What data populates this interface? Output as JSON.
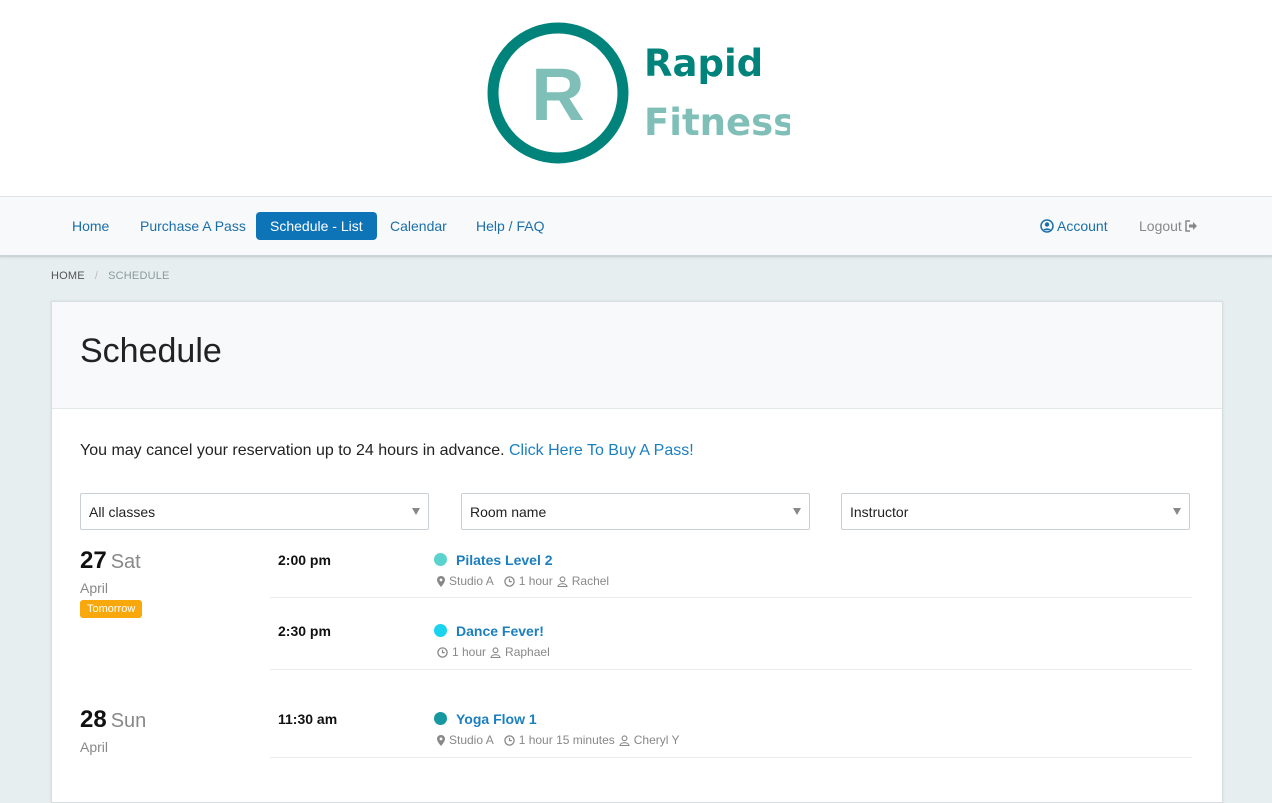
{
  "brand": {
    "line1": "Rapid",
    "line2": "Fitness",
    "mark": "R",
    "primary": "#00837a",
    "secondary": "#7fbfb8"
  },
  "nav": {
    "items": [
      {
        "label": "Home",
        "active": false
      },
      {
        "label": "Purchase A Pass",
        "active": false
      },
      {
        "label": "Schedule - List",
        "active": true
      },
      {
        "label": "Calendar",
        "active": false
      },
      {
        "label": "Help / FAQ",
        "active": false
      }
    ],
    "account_label": "Account",
    "account_icon": "user-circle-icon",
    "logout_label": "Logout",
    "logout_icon": "sign-out-icon"
  },
  "breadcrumb": {
    "home": "HOME",
    "separator": "/",
    "current": "SCHEDULE"
  },
  "page": {
    "title": "Schedule",
    "notice_text": "You may cancel your reservation up to 24 hours in advance. ",
    "notice_link": "Click Here To Buy A Pass!"
  },
  "filters": {
    "class": "All classes",
    "room": "Room name",
    "instructor": "Instructor"
  },
  "days": [
    {
      "date": "27",
      "weekday": "Sat",
      "month": "April",
      "badge": "Tomorrow",
      "classes": [
        {
          "time": "2:00 pm",
          "name": "Pilates Level 2",
          "color": "#5ad3cf",
          "room": "Studio A",
          "duration": "1 hour",
          "instructor": "Rachel"
        },
        {
          "time": "2:30 pm",
          "name": "Dance Fever!",
          "color": "#1ad3ef",
          "duration": "1 hour",
          "instructor": "Raphael"
        }
      ]
    },
    {
      "date": "28",
      "weekday": "Sun",
      "month": "April",
      "classes": [
        {
          "time": "11:30 am",
          "name": "Yoga Flow 1",
          "color": "#1798a0",
          "room": "Studio A",
          "duration": "1 hour 15 minutes",
          "instructor": "Cheryl Y"
        }
      ]
    }
  ]
}
